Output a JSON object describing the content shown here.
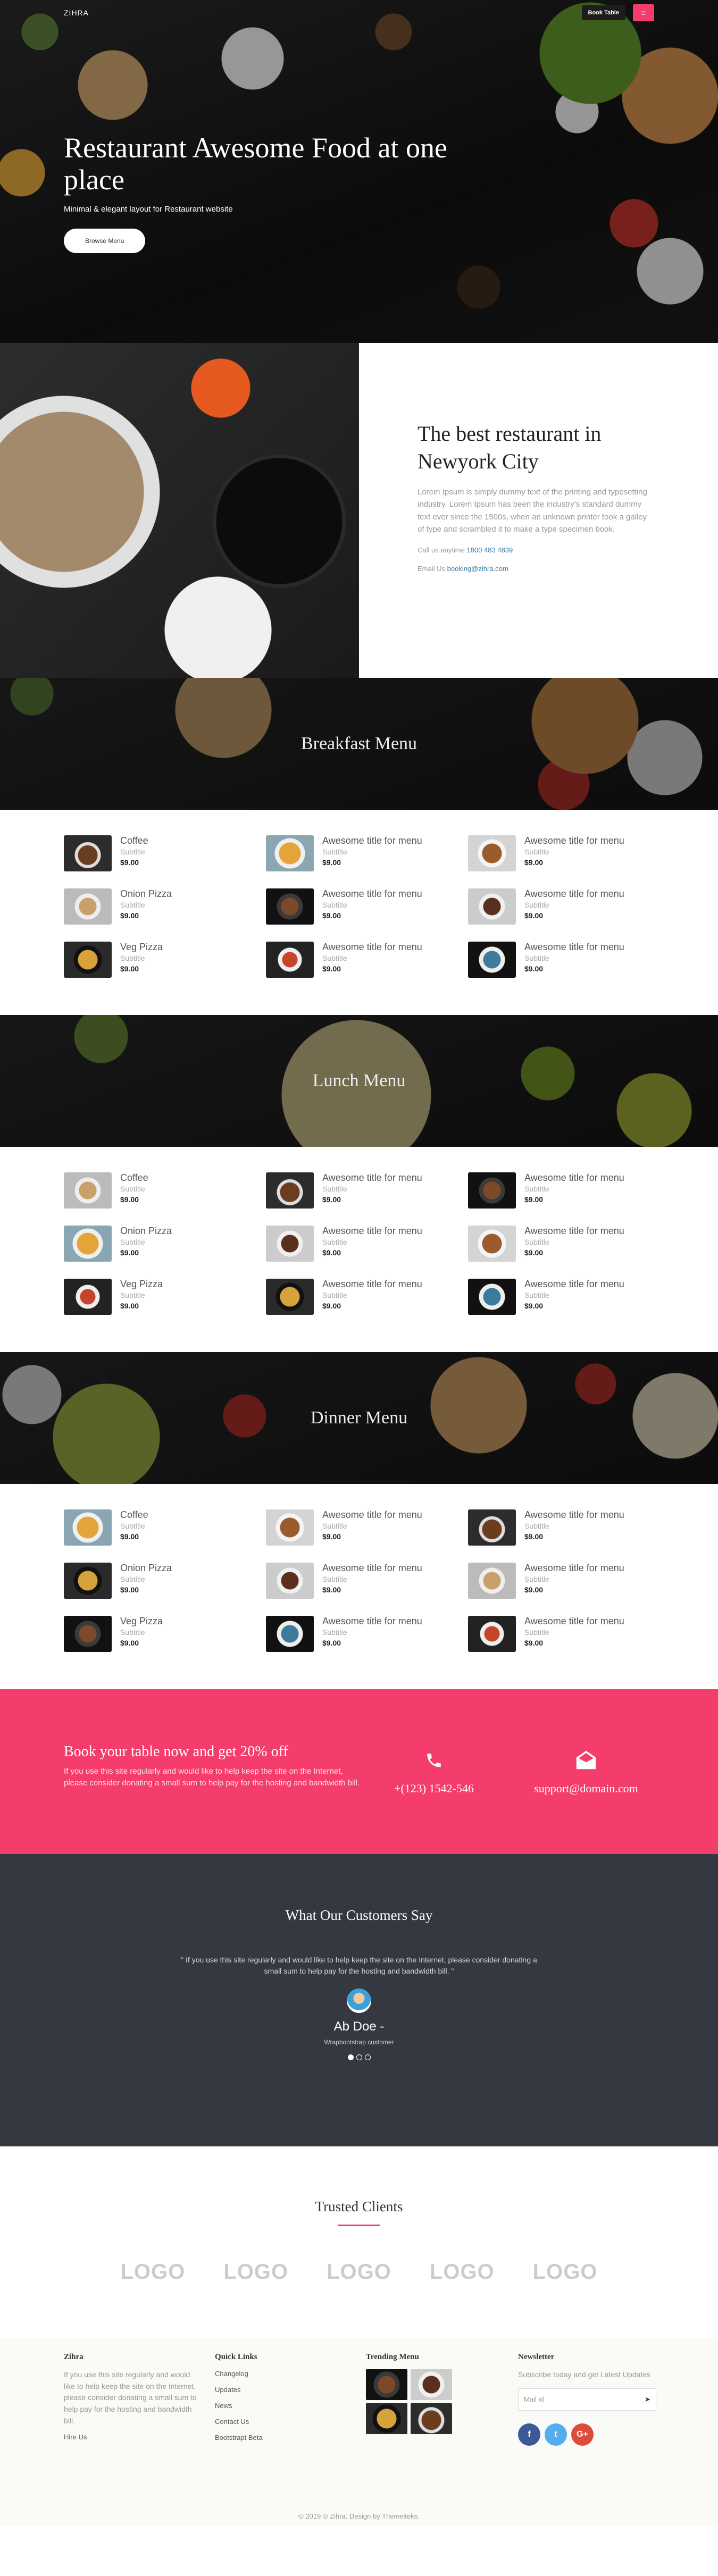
{
  "nav": {
    "logo": "ZIHRA",
    "book_label": "Book Table",
    "menu_icon": "hamburger-icon"
  },
  "hero": {
    "title": "Restaurant Awesome Food at one place",
    "subtitle": "Minimal & elegant layout for Restaurant website",
    "button": "Browse Menu"
  },
  "about": {
    "title": "The best restaurant in Newyork City",
    "description": "Lorem Ipsum is simply dummy text of the printing and typesetting industry. Lorem Ipsum has been the industry's standard dummy text ever since the 1500s, when an unknown printer took a galley of type and scrambled it to make a type specimen book.",
    "call_label": "Call us anytime",
    "call_number": "1800 483 4839",
    "email_label": "Email Us",
    "email": "booking@zihra.com"
  },
  "menus": [
    {
      "title": "Breakfast Menu",
      "items": [
        {
          "title": "Coffee",
          "subtitle": "Subtitle",
          "price": "$9.00"
        },
        {
          "title": "Awesome title for menu",
          "subtitle": "Subtitle",
          "price": "$9.00"
        },
        {
          "title": "Awesome title for menu",
          "subtitle": "Subtitle",
          "price": "$9.00"
        },
        {
          "title": "Onion Pizza",
          "subtitle": "Subtitle",
          "price": "$9.00"
        },
        {
          "title": "Awesome title for menu",
          "subtitle": "Subtitle",
          "price": "$9.00"
        },
        {
          "title": "Awesome title for menu",
          "subtitle": "Subtitle",
          "price": "$9.00"
        },
        {
          "title": "Veg Pizza",
          "subtitle": "Subtitle",
          "price": "$9.00"
        },
        {
          "title": "Awesome title for menu",
          "subtitle": "Subtitle",
          "price": "$9.00"
        },
        {
          "title": "Awesome title for menu",
          "subtitle": "Subtitle",
          "price": "$9.00"
        }
      ]
    },
    {
      "title": "Lunch Menu",
      "items": [
        {
          "title": "Coffee",
          "subtitle": "Subtitle",
          "price": "$9.00"
        },
        {
          "title": "Awesome title for menu",
          "subtitle": "Subtitle",
          "price": "$9.00"
        },
        {
          "title": "Awesome title for menu",
          "subtitle": "Subtitle",
          "price": "$9.00"
        },
        {
          "title": "Onion Pizza",
          "subtitle": "Subtitle",
          "price": "$9.00"
        },
        {
          "title": "Awesome title for menu",
          "subtitle": "Subtitle",
          "price": "$9.00"
        },
        {
          "title": "Awesome title for menu",
          "subtitle": "Subtitle",
          "price": "$9.00"
        },
        {
          "title": "Veg Pizza",
          "subtitle": "Subtitle",
          "price": "$9.00"
        },
        {
          "title": "Awesome title for menu",
          "subtitle": "Subtitle",
          "price": "$9.00"
        },
        {
          "title": "Awesome title for menu",
          "subtitle": "Subtitle",
          "price": "$9.00"
        }
      ]
    },
    {
      "title": "Dinner Menu",
      "items": [
        {
          "title": "Coffee",
          "subtitle": "Subtitle",
          "price": "$9.00"
        },
        {
          "title": "Awesome title for menu",
          "subtitle": "Subtitle",
          "price": "$9.00"
        },
        {
          "title": "Awesome title for menu",
          "subtitle": "Subtitle",
          "price": "$9.00"
        },
        {
          "title": "Onion Pizza",
          "subtitle": "Subtitle",
          "price": "$9.00"
        },
        {
          "title": "Awesome title for menu",
          "subtitle": "Subtitle",
          "price": "$9.00"
        },
        {
          "title": "Awesome title for menu",
          "subtitle": "Subtitle",
          "price": "$9.00"
        },
        {
          "title": "Veg Pizza",
          "subtitle": "Subtitle",
          "price": "$9.00"
        },
        {
          "title": "Awesome title for menu",
          "subtitle": "Subtitle",
          "price": "$9.00"
        },
        {
          "title": "Awesome title for menu",
          "subtitle": "Subtitle",
          "price": "$9.00"
        }
      ]
    }
  ],
  "booking": {
    "title": "Book your table now and get 20% off",
    "text": "If you use this site regularly and would like to help keep the site on the Internet, please consider donating a small sum to help pay for the hosting and bandwidth bill.",
    "phone": "+(123) 1542-546",
    "email": "support@domain.com",
    "phone_icon": "phone-icon",
    "email_icon": "envelope-icon"
  },
  "testimonial": {
    "title": "What Our Customers Say",
    "quote": "\" If you use this site regularly and would like to help keep the site on the Internet, please consider donating a small sum to help pay for the hosting and bandwidth bill. \"",
    "name": "Ab Doe -",
    "role": "Wrapbootstrap customer"
  },
  "clients": {
    "title": "Trusted Clients",
    "logos": [
      "LOGO",
      "LOGO",
      "LOGO",
      "LOGO",
      "LOGO"
    ]
  },
  "footer": {
    "about": {
      "title": "Zihra",
      "text": "If you use this site regularly and would like to help keep the site on the Internet, please consider donating a small sum to help pay for the hosting and bandwidth bill.",
      "link": "Hire Us"
    },
    "quick": {
      "title": "Quick Links",
      "links": [
        "Changelog",
        "Updates",
        "News",
        "Contact Us",
        "Bootstrapt Beta"
      ]
    },
    "trending": {
      "title": "Trending Menu"
    },
    "newsletter": {
      "title": "Newsletter",
      "text": "Subscribe today and get Latest Updates",
      "placeholder": "Mail id",
      "send_icon": "paper-plane-icon"
    },
    "socials": {
      "facebook": "f",
      "twitter": "t",
      "google": "G+"
    },
    "copyright": "© 2019 © Zihra. Design by Themeiteks."
  },
  "colors": {
    "accent": "#f53d6b",
    "dark": "#353840",
    "facebook": "#3b5998",
    "twitter": "#55acee",
    "google": "#dd4b39"
  }
}
